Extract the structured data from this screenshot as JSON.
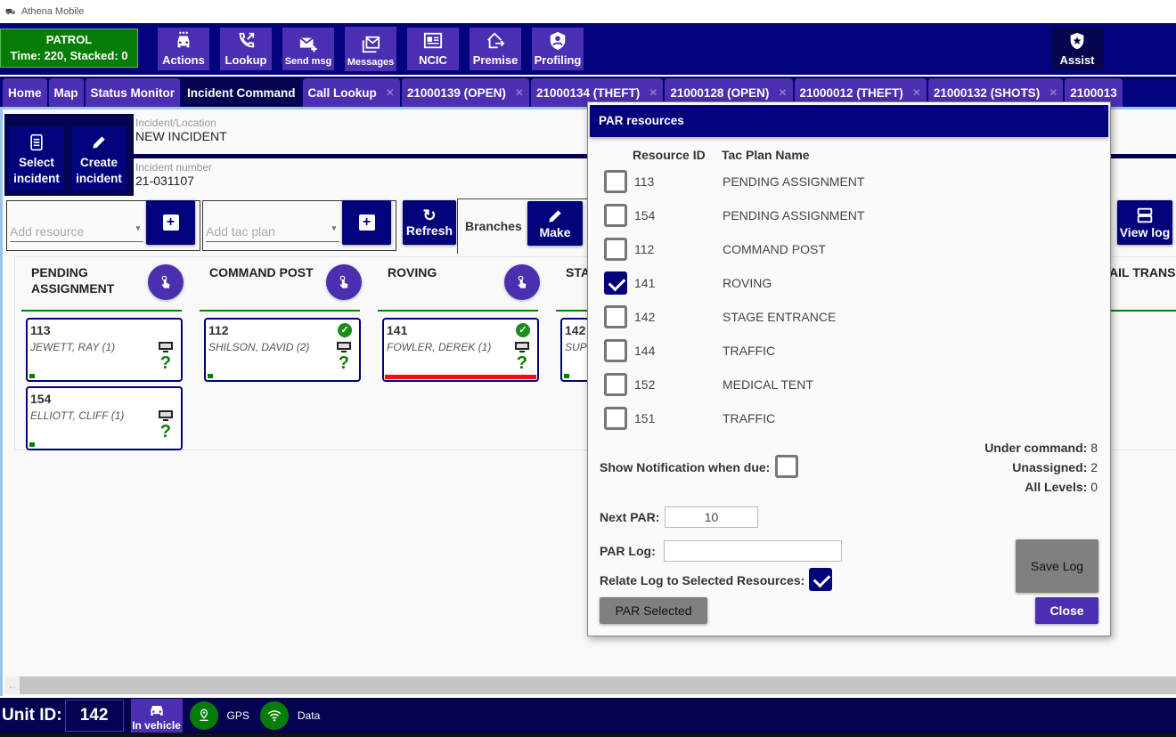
{
  "window": {
    "title": "Athena Mobile"
  },
  "status": {
    "line1": "PATROL",
    "line2": "Time: 220, Stacked: 0"
  },
  "toolbar": {
    "actions": "Actions",
    "lookup": "Lookup",
    "send_msg": "Send msg",
    "messages": "Messages",
    "ncic": "NCIC",
    "premise": "Premise",
    "profiling": "Profiling",
    "assist": "Assist"
  },
  "tabs": [
    {
      "label": "Home",
      "closable": false
    },
    {
      "label": "Map",
      "closable": false
    },
    {
      "label": "Status Monitor",
      "closable": false
    },
    {
      "label": "Incident Command",
      "closable": false,
      "active": true
    },
    {
      "label": "Call Lookup",
      "closable": true
    },
    {
      "label": "21000139 (OPEN)",
      "closable": true
    },
    {
      "label": "21000134 (THEFT)",
      "closable": true
    },
    {
      "label": "21000128 (OPEN)",
      "closable": true
    },
    {
      "label": "21000012 (THEFT)",
      "closable": true
    },
    {
      "label": "21000132 (SHOTS)",
      "closable": true
    },
    {
      "label": "2100013",
      "closable": false
    }
  ],
  "incident": {
    "select_line1": "Select",
    "select_line2": "incident",
    "create_line1": "Create",
    "create_line2": "incident",
    "location_label": "Incident/Location",
    "location_value": "NEW INCIDENT",
    "number_label": "Incident number",
    "number_value": "21-031107"
  },
  "controls": {
    "add_resource_placeholder": "Add resource",
    "add_tac_plan_placeholder": "Add tac plan",
    "refresh": "Refresh",
    "branches": "Branches",
    "make": "Make",
    "view_log": "View log"
  },
  "board": {
    "columns": [
      {
        "name": "PENDING ASSIGNMENT",
        "cards": [
          {
            "id": "113",
            "name": "JEWETT, RAY (1)",
            "checked": false,
            "alert": false
          },
          {
            "id": "154",
            "name": "ELLIOTT, CLIFF (1)",
            "checked": false,
            "alert": false
          }
        ]
      },
      {
        "name": "COMMAND POST",
        "cards": [
          {
            "id": "112",
            "name": "SHILSON, DAVID (2)",
            "checked": true,
            "alert": false
          }
        ]
      },
      {
        "name": "ROVING",
        "cards": [
          {
            "id": "141",
            "name": "FOWLER, DEREK (1)",
            "checked": true,
            "alert": true
          }
        ]
      },
      {
        "name": "STA",
        "cards": [
          {
            "id": "142",
            "name": "SUPP",
            "checked": false,
            "alert": false
          }
        ]
      }
    ],
    "offscreen_column": "AIL TRANSP",
    "question_mark": "?",
    "check_glyph": "✓"
  },
  "dialog": {
    "title": "PAR resources",
    "col_resource": "Resource ID",
    "col_tac_plan": "Tac Plan Name",
    "rows": [
      {
        "id": "113",
        "plan": "PENDING ASSIGNMENT",
        "checked": false
      },
      {
        "id": "154",
        "plan": "PENDING ASSIGNMENT",
        "checked": false
      },
      {
        "id": "112",
        "plan": "COMMAND POST",
        "checked": false
      },
      {
        "id": "141",
        "plan": "ROVING",
        "checked": true
      },
      {
        "id": "142",
        "plan": "STAGE ENTRANCE",
        "checked": false
      },
      {
        "id": "144",
        "plan": "TRAFFIC",
        "checked": false
      },
      {
        "id": "152",
        "plan": "MEDICAL TENT",
        "checked": false
      },
      {
        "id": "151",
        "plan": "TRAFFIC",
        "checked": false
      }
    ],
    "under_command_label": "Under command:",
    "under_command": "8",
    "unassigned_label": "Unassigned:",
    "unassigned": "2",
    "all_levels_label": "All Levels:",
    "all_levels": "0",
    "show_notification_label": "Show Notification when due:",
    "show_notification": false,
    "next_par_label": "Next PAR:",
    "next_par": "10",
    "par_log_label": "PAR Log:",
    "par_log": "",
    "relate_label": "Relate Log to Selected Resources:",
    "relate": true,
    "save_log": "Save Log",
    "par_selected": "PAR Selected",
    "close": "Close"
  },
  "statusbar": {
    "unit_label": "Unit ID:",
    "unit_id": "142",
    "vehicle": "In vehicle",
    "gps": "GPS",
    "data": "Data",
    "gps_color": "#067d06",
    "data_color": "#067d06"
  }
}
